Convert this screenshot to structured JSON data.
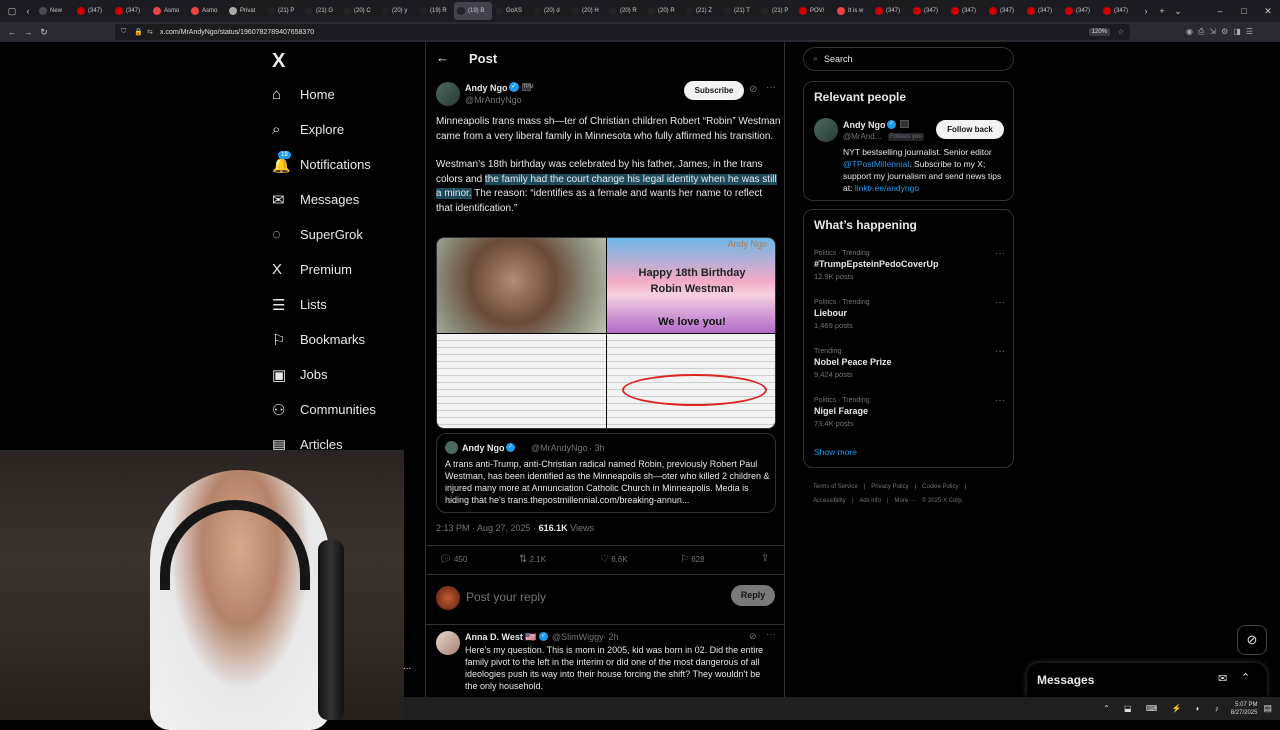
{
  "browser": {
    "tabs": [
      "New",
      "(347)",
      "(347)",
      "Asmo",
      "Asmo",
      "Privat",
      "(21) P",
      "(21) G",
      "(20) C",
      "(20) y",
      "(19) R",
      "(19) B",
      "GoXS",
      "(20) d",
      "(20) H",
      "(20) R",
      "(20) R",
      "(21) Z",
      "(21) T",
      "(21) P",
      "POV/",
      "It is w",
      "(347)",
      "(347)",
      "(347)",
      "(347)",
      "(347)",
      "(347)",
      "(347)"
    ],
    "url": "x.com/MrAndyNgo/status/1960782789407658370",
    "zoom": "120%"
  },
  "nav": {
    "logo": "X",
    "items": [
      {
        "label": "Home",
        "icon": "⌂"
      },
      {
        "label": "Explore",
        "icon": "⌕"
      },
      {
        "label": "Notifications",
        "icon": "🔔"
      },
      {
        "label": "Messages",
        "icon": "✉"
      },
      {
        "label": "SuperGrok",
        "icon": "◌"
      },
      {
        "label": "Premium",
        "icon": "X"
      },
      {
        "label": "Lists",
        "icon": "☰"
      },
      {
        "label": "Bookmarks",
        "icon": "⚐"
      },
      {
        "label": "Jobs",
        "icon": "▣"
      },
      {
        "label": "Communities",
        "icon": "⚇"
      },
      {
        "label": "Articles",
        "icon": "▤"
      }
    ],
    "notif_badge": "19",
    "more": "..."
  },
  "post": {
    "header": "Post",
    "author": "Andy Ngo",
    "handle": "@MrAndyNgo",
    "subscribe": "Subscribe",
    "p1": "Minneapolis trans mass sh—ter of Christian children Robert “Robin” Westman came from a very liberal family in Minnesota who fully affirmed his transition.",
    "p2a": "Westman’s 18th birthday was celebrated by his father, James, in the trans colors and ",
    "p2b": "the family had the court change his legal identity when he was still a minor.",
    "p2c": " The reason: “identifies as a female and wants her name to reflect that identification.”",
    "img_watermark": "Andy Ngo",
    "img_bday1": "Happy 18th Birthday",
    "img_bday2": "Robin Westman",
    "img_love": "We love you!",
    "quote": {
      "author": "Andy Ngo",
      "handle": "@MrAndyNgo",
      "time": "· 3h",
      "text": "A trans anti-Trump, anti-Christian radical named Robin, previously Robert Paul Westman, has been identified as the Minneapolis sh—oter who killed 2 children & injured many more at Annunciation Catholic Church in Minneapolis. Media is hiding that he's trans.thepostmillennial.com/breaking-annun..."
    },
    "timestamp": "2:13 PM · Aug 27, 2025 · ",
    "views_count": "616.1K",
    "views_label": " Views",
    "replies": "450",
    "reposts": "2.1K",
    "likes": "6.6K",
    "bookmarks": "628",
    "reply_placeholder": "Post your reply",
    "reply_btn": "Reply"
  },
  "reply": {
    "author": "Anna D. West 🇺🇸",
    "handle": "@SlimWiggy",
    "time": "· 2h",
    "text": "Here's my question. This is mom in 2005, kid was born in 02. Did the entire family pivot to the left in the interim or did one of the most dangerous of all ideologies push its way into their house forcing the shift? They wouldn't be the only household."
  },
  "right": {
    "search_placeholder": "Search",
    "relevant_title": "Relevant people",
    "rp_name": "Andy Ngo",
    "rp_handle": "@MrAnd...",
    "rp_follows": "Follows you",
    "rp_btn": "Follow back",
    "rp_bio1": "NYT bestselling journalist. Senior editor ",
    "rp_bio_link1": "@TPostMillennial",
    "rp_bio2": ". Subscribe to my X; support my journalism and send news tips at: ",
    "rp_bio_link2": "linktr.ee/andyngo",
    "happening_title": "What’s happening",
    "trends": [
      {
        "cat": "Politics · Trending",
        "name": "#TrumpEpsteinPedoCoverUp",
        "posts": "12.9K posts"
      },
      {
        "cat": "Politics · Trending",
        "name": "Liebour",
        "posts": "1,469 posts"
      },
      {
        "cat": "Trending",
        "name": "Nobel Peace Prize",
        "posts": "9,424 posts"
      },
      {
        "cat": "Politics · Trending",
        "name": "Nigel Farage",
        "posts": "73.4K posts"
      }
    ],
    "show_more": "Show more",
    "footer1": [
      "Terms of Service",
      "|",
      "Privacy Policy",
      "|",
      "Cookie Policy",
      "|"
    ],
    "footer2": [
      "Accessibility",
      "|",
      "Ads info",
      "|",
      "More ···",
      "© 2025 X Corp."
    ]
  },
  "messages_dock": "Messages",
  "taskbar": {
    "time": "5:07 PM",
    "date": "8/27/2025"
  }
}
